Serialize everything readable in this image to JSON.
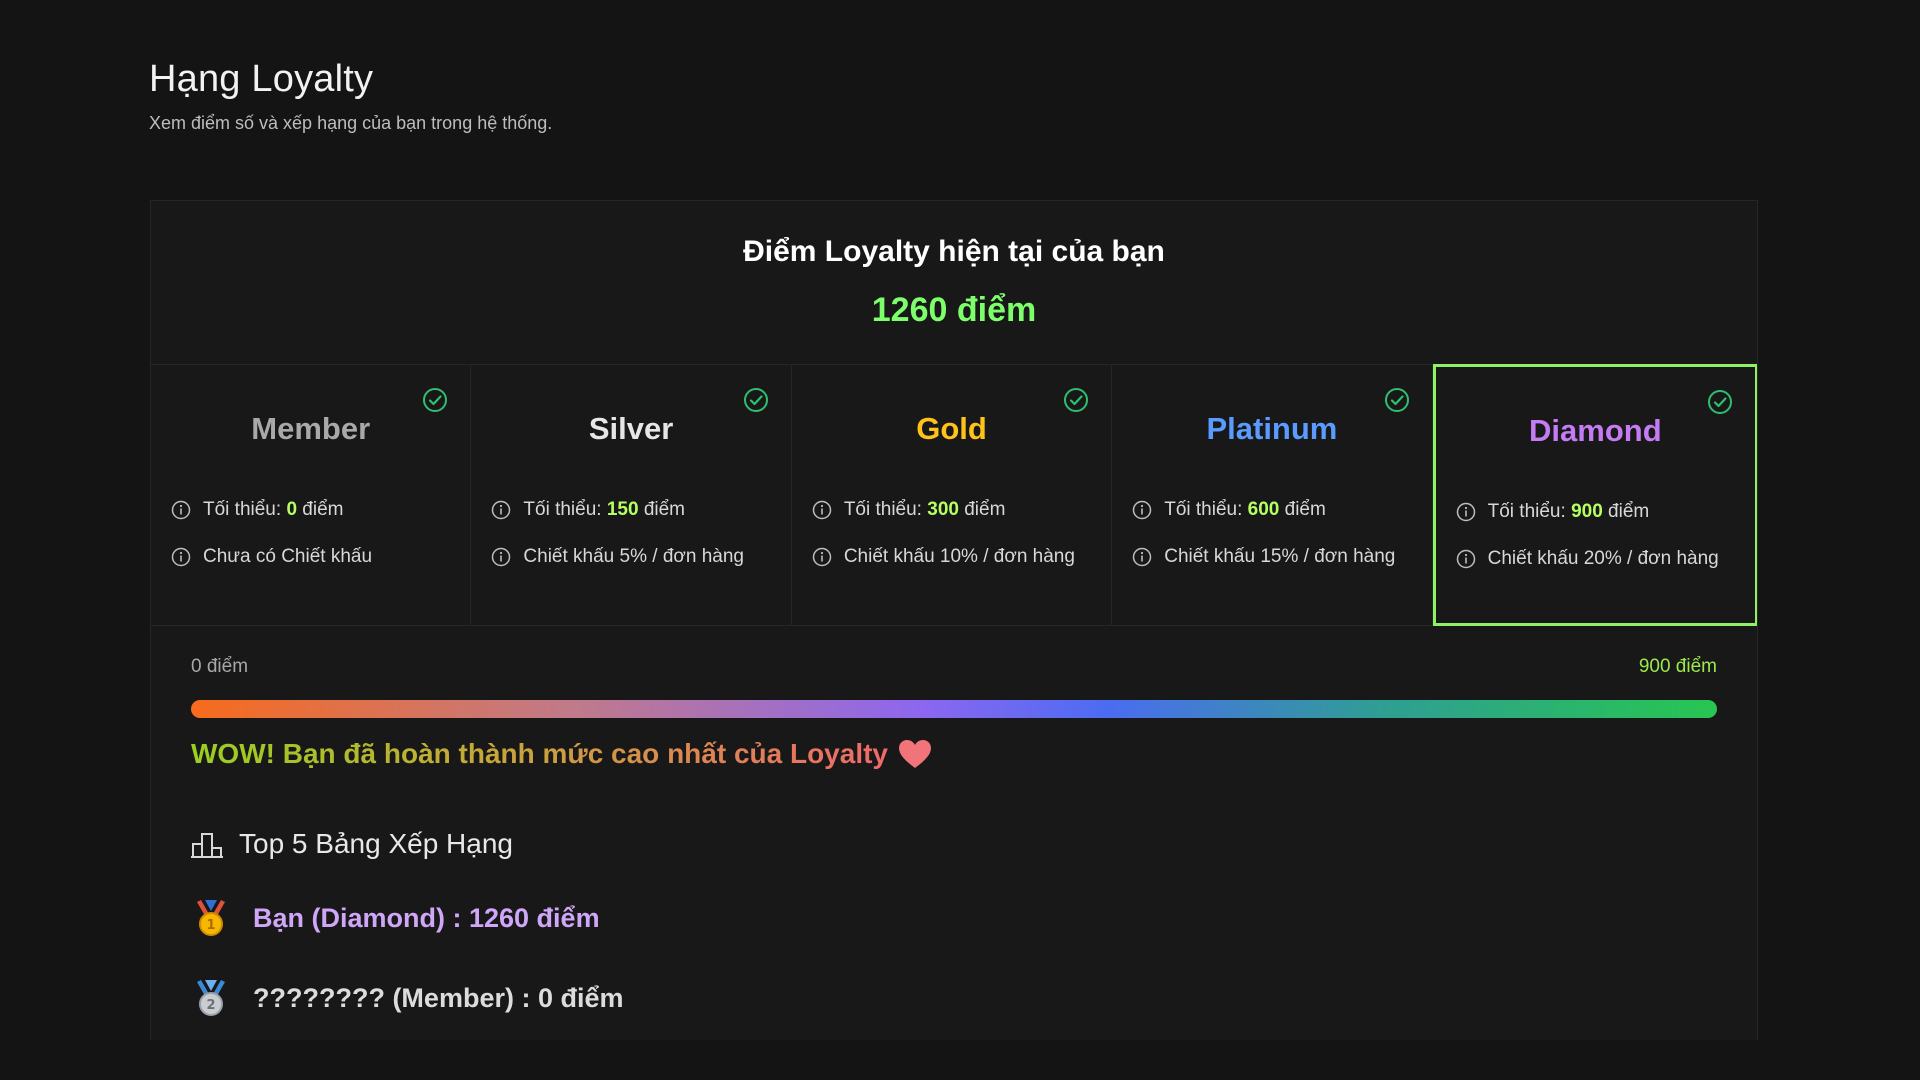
{
  "header": {
    "title": "Hạng Loyalty",
    "subtitle": "Xem điểm số và xếp hạng của bạn trong hệ thống."
  },
  "points": {
    "label": "Điểm Loyalty hiện tại của bạn",
    "value": "1260 điểm"
  },
  "tiers": [
    {
      "name": "Member",
      "color": "#a9a9a9",
      "min_prefix": "Tối thiểu:",
      "min_value": "0",
      "min_suffix": "điểm",
      "perk": "Chưa có Chiết khấu",
      "achieved": true,
      "active": false
    },
    {
      "name": "Silver",
      "color": "#e6e6e6",
      "min_prefix": "Tối thiểu:",
      "min_value": "150",
      "min_suffix": "điểm",
      "perk": "Chiết khấu 5% / đơn hàng",
      "achieved": true,
      "active": false
    },
    {
      "name": "Gold",
      "color": "#ffc21a",
      "min_prefix": "Tối thiểu:",
      "min_value": "300",
      "min_suffix": "điểm",
      "perk": "Chiết khấu 10% / đơn hàng",
      "achieved": true,
      "active": false
    },
    {
      "name": "Platinum",
      "color": "#5a9bff",
      "min_prefix": "Tối thiểu:",
      "min_value": "600",
      "min_suffix": "điểm",
      "perk": "Chiết khấu 15% / đơn hàng",
      "achieved": true,
      "active": false
    },
    {
      "name": "Diamond",
      "color": "#c47cf5",
      "min_prefix": "Tối thiểu:",
      "min_value": "900",
      "min_suffix": "điểm",
      "perk": "Chiết khấu 20% / đơn hàng",
      "achieved": true,
      "active": true
    }
  ],
  "progress": {
    "start_label": "0 điểm",
    "end_label": "900 điểm",
    "fraction": 1.0,
    "message": "WOW! Bạn đã hoàn thành mức cao nhất của Loyalty"
  },
  "leaderboard": {
    "title": "Top 5 Bảng Xếp Hạng",
    "entries": [
      {
        "rank": 1,
        "text": "Bạn (Diamond) : 1260 điểm",
        "medal_icon": "gold-medal-icon"
      },
      {
        "rank": 2,
        "text": "???????? (Member) : 0 điểm",
        "medal_icon": "silver-medal-icon"
      }
    ]
  },
  "colors": {
    "background": "#141414",
    "accent_green": "#7dff6b",
    "active_border": "#8ff264",
    "check_green": "#2fbf71"
  }
}
